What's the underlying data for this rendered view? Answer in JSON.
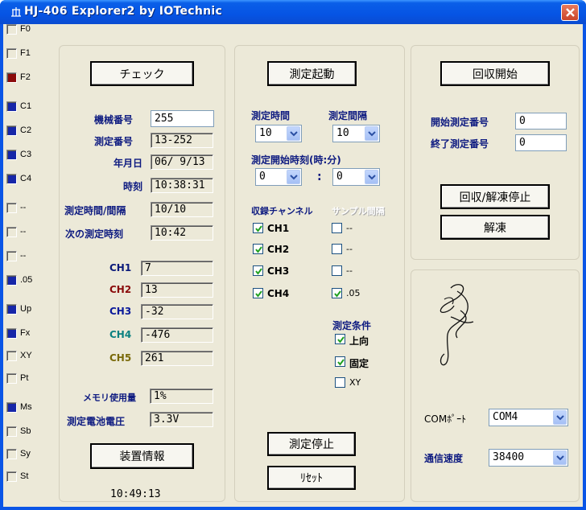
{
  "window": {
    "title": "HJ-406 Explorer2 by IOTechnic"
  },
  "side_indicators": [
    {
      "label": "F0",
      "state": "off"
    },
    {
      "label": "F1",
      "state": "off"
    },
    {
      "label": "F2",
      "state": "red"
    },
    {
      "label": "C1",
      "state": "blue"
    },
    {
      "label": "C2",
      "state": "blue"
    },
    {
      "label": "C3",
      "state": "blue"
    },
    {
      "label": "C4",
      "state": "blue"
    },
    {
      "label": "--",
      "state": "off"
    },
    {
      "label": "--",
      "state": "off"
    },
    {
      "label": "--",
      "state": "off"
    },
    {
      "label": ".05",
      "state": "blue"
    },
    {
      "label": "Up",
      "state": "blue"
    },
    {
      "label": "Fx",
      "state": "blue"
    },
    {
      "label": "XY",
      "state": "off"
    },
    {
      "label": "Pt",
      "state": "off"
    },
    {
      "label": "Ms",
      "state": "blue"
    },
    {
      "label": "Sb",
      "state": "off"
    },
    {
      "label": "Sy",
      "state": "off"
    },
    {
      "label": "St",
      "state": "off"
    }
  ],
  "left": {
    "check_button": "チェック",
    "device_no_label": "機械番号",
    "device_no_value": "255",
    "meas_no_label": "測定番号",
    "meas_no_value": "13-252",
    "date_label": "年月日",
    "date_value": "06/ 9/13",
    "time_label": "時刻",
    "time_value": "10:38:31",
    "interval_label": "測定時間/間隔",
    "interval_value": "10/10",
    "next_time_label": "次の測定時刻",
    "next_time_value": "10:42",
    "channels": [
      {
        "label": "CH1",
        "value": "7",
        "color": "#0a1a7a"
      },
      {
        "label": "CH2",
        "value": "13",
        "color": "#8a0a0a"
      },
      {
        "label": "CH3",
        "value": "-32",
        "color": "#0a1a9a"
      },
      {
        "label": "CH4",
        "value": "-476",
        "color": "#0a8080"
      },
      {
        "label": "CH5",
        "value": "261",
        "color": "#7a6a0a"
      }
    ],
    "memory_label": "メモリ使用量",
    "memory_value": "1%",
    "battery_label": "測定電池電圧",
    "battery_value": "3.3V",
    "device_info_button": "装置情報",
    "clock": "10:49:13"
  },
  "middle": {
    "start_button": "測定起動",
    "meas_time_label": "測定時間",
    "meas_time_value": "10",
    "meas_interval_label": "測定間隔",
    "meas_interval_value": "10",
    "start_time_label": "測定開始時刻(時:分)",
    "start_hour_value": "0",
    "colon": ":",
    "start_min_value": "0",
    "rec_channel_label": "収録チャンネル",
    "sample_interval_label": "サンプル間隔",
    "channel_checks": [
      {
        "label": "CH1",
        "checked": true
      },
      {
        "label": "CH2",
        "checked": true
      },
      {
        "label": "CH3",
        "checked": true
      },
      {
        "label": "CH4",
        "checked": true
      }
    ],
    "sample_checks": [
      {
        "label": "--",
        "checked": false
      },
      {
        "label": "--",
        "checked": false
      },
      {
        "label": "--",
        "checked": false
      },
      {
        "label": ".05",
        "checked": true
      }
    ],
    "conditions_label": "測定条件",
    "condition_checks": [
      {
        "label": "上向",
        "checked": true
      },
      {
        "label": "固定",
        "checked": true
      },
      {
        "label": "XY",
        "checked": false
      }
    ],
    "stop_button": "測定停止",
    "reset_button": "ﾘｾｯﾄ"
  },
  "right": {
    "collect_button": "回収開始",
    "start_no_label": "開始測定番号",
    "start_no_value": "0",
    "end_no_label": "終了測定番号",
    "end_no_value": "0",
    "collect_stop_button": "回収/解凍停止",
    "thaw_button": "解凍",
    "com_port_label": "COMﾎﾟｰﾄ",
    "com_port_value": "COM4",
    "baud_label": "通信速度",
    "baud_value": "38400"
  }
}
